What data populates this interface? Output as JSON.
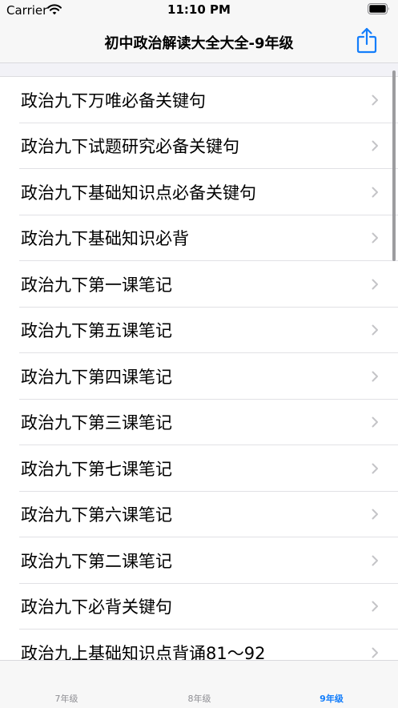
{
  "status_bar": {
    "carrier": "Carrier",
    "time": "11:10 PM"
  },
  "nav": {
    "title": "初中政治解读大全大全-9年级"
  },
  "list": {
    "items": [
      "政治九下万唯必备关键句",
      "政治九下试题研究必备关键句",
      "政治九下基础知识点必备关键句",
      "政治九下基础知识必背",
      "政治九下第一课笔记",
      "政治九下第五课笔记",
      "政治九下第四课笔记",
      "政治九下第三课笔记",
      "政治九下第七课笔记",
      "政治九下第六课笔记",
      "政治九下第二课笔记",
      "政治九下必背关键句",
      "政治九上基础知识点背诵81～92"
    ]
  },
  "tabs": [
    {
      "label": "7年级",
      "selected": false
    },
    {
      "label": "8年级",
      "selected": false
    },
    {
      "label": "9年级",
      "selected": true
    }
  ],
  "colors": {
    "accent": "#147efb",
    "tab_inactive": "#8e8e93",
    "chevron": "#c4c4c7"
  },
  "icons": {
    "status": [
      "wifi-icon",
      "battery-icon"
    ],
    "nav": "share-icon",
    "row": "chevron-right-icon"
  }
}
